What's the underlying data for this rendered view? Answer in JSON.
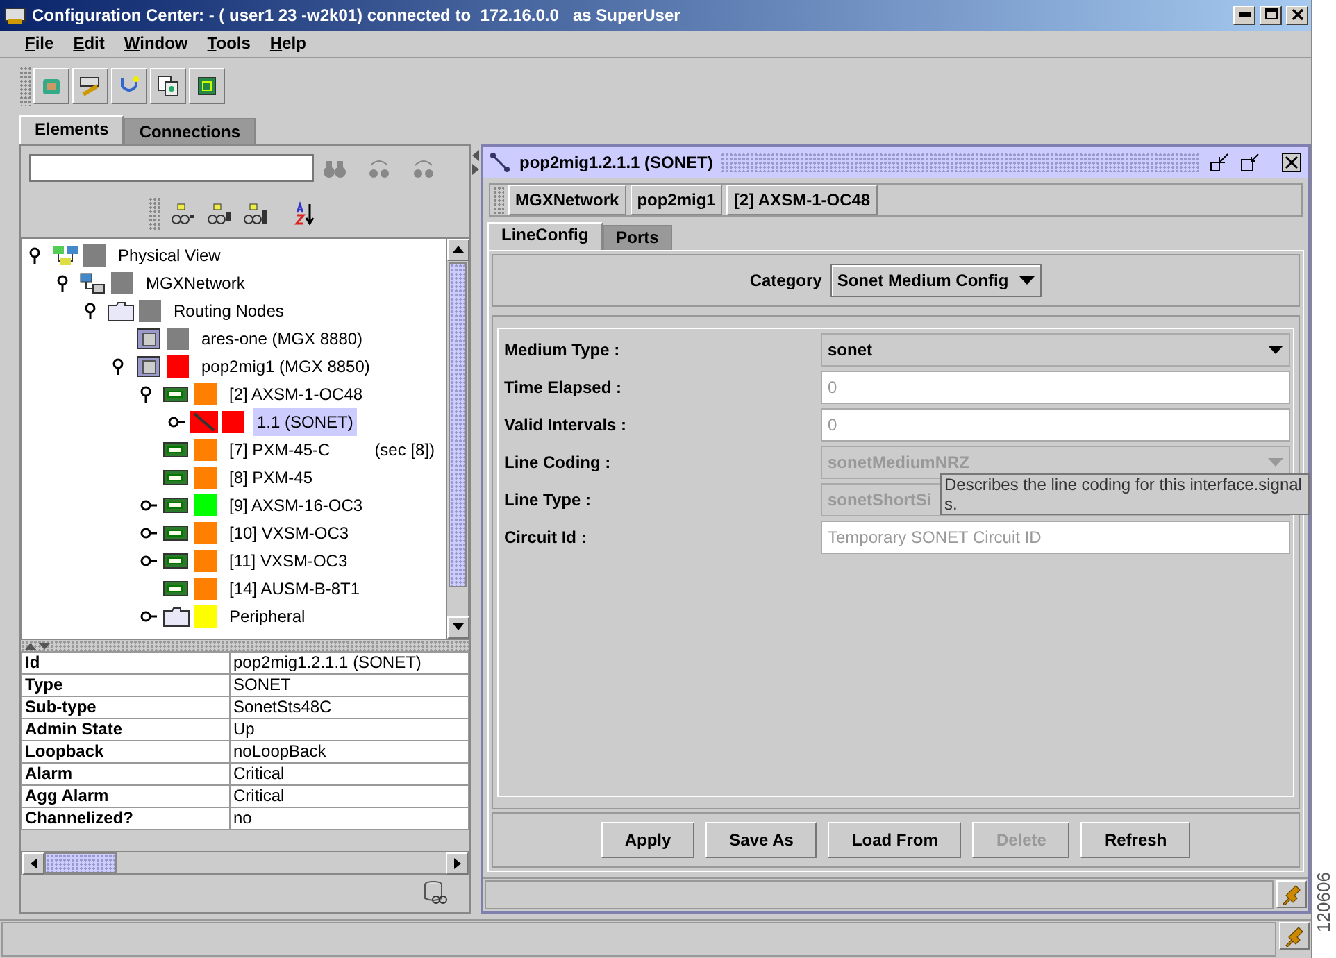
{
  "window": {
    "title": "Configuration Center: - ( user1 23 -w2k01) connected to  172.16.0.0   as SuperUser"
  },
  "menu": [
    "File",
    "Edit",
    "Window",
    "Tools",
    "Help"
  ],
  "main_tabs": [
    {
      "label": "Elements",
      "selected": true
    },
    {
      "label": "Connections",
      "selected": false
    }
  ],
  "tree": [
    {
      "label": "Physical View",
      "kind": "network",
      "color": "#808080",
      "expanded": true,
      "selected": false,
      "children": [
        {
          "label": "MGXNetwork",
          "kind": "hierarchy",
          "color": "#808080",
          "expanded": true,
          "selected": false,
          "children": [
            {
              "label": "Routing Nodes",
              "kind": "folder",
              "color": "#808080",
              "expanded": true,
              "selected": false,
              "children": [
                {
                  "label": "ares-one (MGX 8880)",
                  "kind": "node",
                  "color": "#808080",
                  "selected": false
                },
                {
                  "label": "pop2mig1 (MGX 8850)",
                  "kind": "node",
                  "color": "#ff0000",
                  "expanded": true,
                  "selected": false,
                  "children": [
                    {
                      "label": "[2] AXSM-1-OC48",
                      "kind": "card",
                      "color": "#ff8000",
                      "expanded": true,
                      "selected": false,
                      "children": [
                        {
                          "label": "1.1  (SONET)",
                          "kind": "line",
                          "color": "#ff0000",
                          "expanded": false,
                          "selected": true
                        }
                      ]
                    },
                    {
                      "label": "[7] PXM-45-C",
                      "note": "(sec [8])",
                      "kind": "card",
                      "color": "#ff8000",
                      "selected": false
                    },
                    {
                      "label": "[8] PXM-45",
                      "kind": "card",
                      "color": "#ff8000",
                      "selected": false
                    },
                    {
                      "label": "[9] AXSM-16-OC3",
                      "kind": "card",
                      "color": "#00ff00",
                      "expanded": false,
                      "selected": false
                    },
                    {
                      "label": "[10] VXSM-OC3",
                      "kind": "card",
                      "color": "#ff8000",
                      "expanded": false,
                      "selected": false
                    },
                    {
                      "label": "[11] VXSM-OC3",
                      "kind": "card",
                      "color": "#ff8000",
                      "expanded": false,
                      "selected": false
                    },
                    {
                      "label": "[14] AUSM-B-8T1",
                      "kind": "card",
                      "color": "#ff8000",
                      "selected": false
                    },
                    {
                      "label": "Peripheral",
                      "kind": "folder",
                      "color": "#ffff00",
                      "expanded": false,
                      "selected": false
                    }
                  ]
                }
              ]
            }
          ]
        }
      ]
    }
  ],
  "properties": [
    {
      "name": "Id",
      "value": "pop2mig1.2.1.1  (SONET)"
    },
    {
      "name": "Type",
      "value": "SONET"
    },
    {
      "name": "Sub-type",
      "value": "SonetSts48C"
    },
    {
      "name": "Admin State",
      "value": "Up"
    },
    {
      "name": "Loopback",
      "value": "noLoopBack"
    },
    {
      "name": "Alarm",
      "value": "Critical"
    },
    {
      "name": "Agg Alarm",
      "value": "Critical"
    },
    {
      "name": "Channelized?",
      "value": "no"
    }
  ],
  "detail": {
    "title": "pop2mig1.2.1.1  (SONET)",
    "breadcrumb": [
      "MGXNetwork",
      "pop2mig1",
      "[2] AXSM-1-OC48"
    ],
    "tabs": [
      {
        "label": "LineConfig",
        "selected": true
      },
      {
        "label": "Ports",
        "selected": false
      }
    ],
    "category": {
      "label": "Category",
      "value": "Sonet Medium Config"
    },
    "fields": [
      {
        "label": "Medium Type :",
        "kind": "select",
        "value": "sonet",
        "disabled": false
      },
      {
        "label": "Time Elapsed :",
        "kind": "text",
        "value": "0",
        "disabled": true
      },
      {
        "label": "Valid Intervals :",
        "kind": "text",
        "value": "0",
        "disabled": true
      },
      {
        "label": "Line Coding :",
        "kind": "select",
        "value": "sonetMediumNRZ",
        "disabled": true
      },
      {
        "label": "Line Type :",
        "kind": "select",
        "value": "sonetShortSi",
        "disabled": true,
        "under_tooltip": true
      },
      {
        "label": "Circuit Id :",
        "kind": "text",
        "value": "Temporary SONET Circuit ID",
        "disabled": true
      }
    ],
    "tooltip": "Describes the line coding for this interface.signals.",
    "buttons": [
      {
        "label": "Apply",
        "disabled": false
      },
      {
        "label": "Save As",
        "disabled": false
      },
      {
        "label": "Load From",
        "disabled": false
      },
      {
        "label": "Delete",
        "disabled": true
      },
      {
        "label": "Refresh",
        "disabled": false
      }
    ]
  },
  "figure_number": "120606"
}
